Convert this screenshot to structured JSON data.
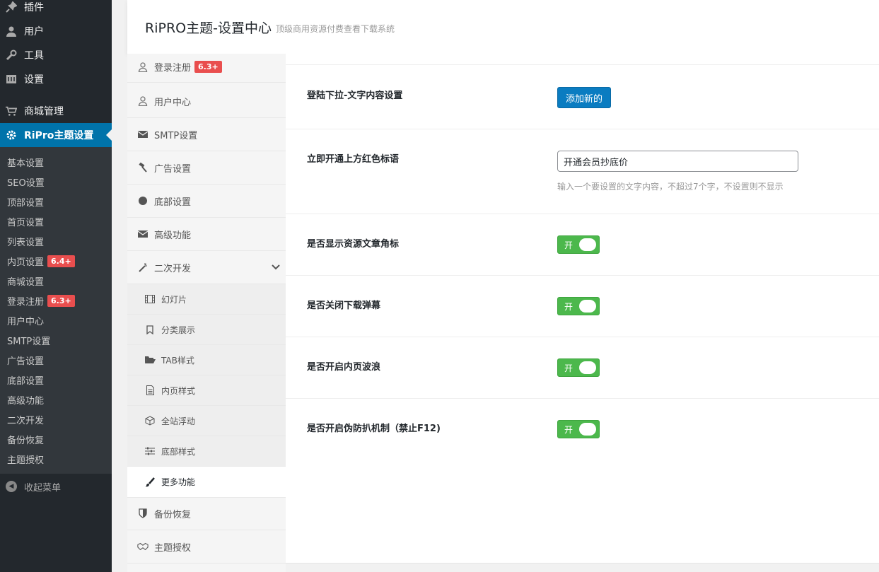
{
  "wp_menu": {
    "items": [
      {
        "label": "插件",
        "icon": "plugin-icon"
      },
      {
        "label": "用户",
        "icon": "user-icon"
      },
      {
        "label": "工具",
        "icon": "wrench-icon"
      },
      {
        "label": "设置",
        "icon": "settings-icon"
      },
      {
        "label": "商城管理",
        "icon": "cart-icon"
      },
      {
        "label": "RiPro主题设置",
        "icon": "gear-icon"
      }
    ],
    "submenu": [
      {
        "label": "基本设置"
      },
      {
        "label": "SEO设置"
      },
      {
        "label": "顶部设置"
      },
      {
        "label": "首页设置"
      },
      {
        "label": "列表设置"
      },
      {
        "label": "内页设置",
        "badge": "6.4+"
      },
      {
        "label": "商城设置"
      },
      {
        "label": "登录注册",
        "badge": "6.3+"
      },
      {
        "label": "用户中心"
      },
      {
        "label": "SMTP设置"
      },
      {
        "label": "广告设置"
      },
      {
        "label": "底部设置"
      },
      {
        "label": "高级功能"
      },
      {
        "label": "二次开发"
      },
      {
        "label": "备份恢复"
      },
      {
        "label": "主题授权"
      }
    ],
    "collapse_label": "收起菜单"
  },
  "header": {
    "title": "RiPRO主题-设置中心",
    "subtitle": "顶级商用资源付费查看下载系统"
  },
  "settings_nav": {
    "items": [
      {
        "label": "登录注册",
        "badge": "6.3+",
        "icon": "user-outline-icon"
      },
      {
        "label": "用户中心",
        "icon": "user-outline-icon"
      },
      {
        "label": "SMTP设置",
        "icon": "envelope-icon"
      },
      {
        "label": "广告设置",
        "icon": "hammer-icon"
      },
      {
        "label": "底部设置",
        "icon": "circle-icon"
      },
      {
        "label": "高级功能",
        "icon": "envelope-icon"
      },
      {
        "label": "二次开发",
        "icon": "magic-wand-icon"
      }
    ],
    "sub_items": [
      {
        "label": "幻灯片",
        "icon": "film-icon"
      },
      {
        "label": "分类展示",
        "icon": "bookmark-icon"
      },
      {
        "label": "TAB样式",
        "icon": "folder-open-icon"
      },
      {
        "label": "内页样式",
        "icon": "file-text-icon"
      },
      {
        "label": "全站浮动",
        "icon": "cube-icon"
      },
      {
        "label": "底部样式",
        "icon": "sliders-icon"
      },
      {
        "label": "更多功能",
        "icon": "paint-brush-icon",
        "active": true
      }
    ],
    "bottom_items": [
      {
        "label": "备份恢复",
        "icon": "shield-icon"
      },
      {
        "label": "主题授权",
        "icon": "handshake-icon"
      }
    ]
  },
  "main": {
    "rows": [
      {
        "label": "登陆下拉-文字内容设置",
        "button": "添加新的"
      },
      {
        "label": "立即开通上方红色标语",
        "value": "开通会员抄底价",
        "desc": "输入一个要设置的文字内容，不超过7个字，不设置则不显示"
      },
      {
        "label": "是否显示资源文章角标",
        "toggle": "开"
      },
      {
        "label": "是否关闭下载弹幕",
        "toggle": "开"
      },
      {
        "label": "是否开启内页波浪",
        "toggle": "开"
      },
      {
        "label": "是否开启伪防扒机制（禁止F12)",
        "toggle": "开"
      }
    ]
  },
  "colors": {
    "wp_sidebar": "#23282d",
    "wp_active": "#0073aa",
    "badge": "#e94e4e",
    "toggle_on": "#4cb84c",
    "button": "#0a7cc1"
  }
}
